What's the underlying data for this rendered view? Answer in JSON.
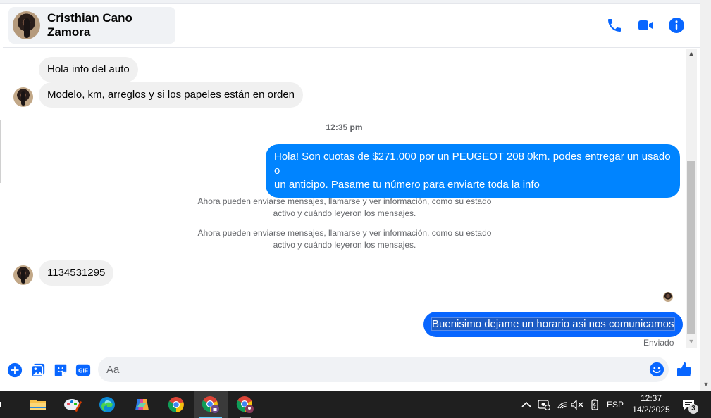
{
  "header": {
    "contact_name": "Cristhian Cano Zamora",
    "icons": [
      "phone-icon",
      "video-call-icon",
      "info-icon"
    ]
  },
  "messages": [
    {
      "direction": "in",
      "text": "Hola info del auto"
    },
    {
      "direction": "in",
      "text": "Modelo, km, arreglos y si los papeles están en orden"
    },
    {
      "type": "timestamp",
      "text": "12:35 pm"
    },
    {
      "direction": "out",
      "line1": "Hola! Son cuotas de $271.000 por un PEUGEOT 208 0km. podes entregar un usado o",
      "line2": "un anticipo. Pasame tu número para enviarte toda la info"
    },
    {
      "type": "system",
      "line1": "Ahora pueden enviarse mensajes, llamarse y ver información, como su estado",
      "line2": "activo y cuándo leyeron los mensajes."
    },
    {
      "type": "system",
      "line1": "Ahora pueden enviarse mensajes, llamarse y ver información, como su estado",
      "line2": "activo y cuándo leyeron los mensajes."
    },
    {
      "direction": "in",
      "text": "1134531295"
    },
    {
      "direction": "out",
      "text": "Buenisimo dejame un horario asi nos comunicamos",
      "status": "Enviado"
    }
  ],
  "composer": {
    "placeholder": "Aa",
    "icons": [
      "plus-icon",
      "photo-icon",
      "sticker-icon",
      "gif-icon",
      "emoji-icon",
      "like-icon"
    ],
    "gif_label": "GIF"
  },
  "taskbar": {
    "apps": [
      "task-view",
      "file-explorer",
      "paint-app",
      "edge-browser",
      "copilot-app",
      "chrome-browser",
      "chrome-profile-active",
      "chrome-profile-2"
    ],
    "language": "ESP",
    "time": "12:37",
    "date": "14/2/2025",
    "notifications": "3"
  },
  "colors": {
    "accent": "#0866ff",
    "outgoing_bubble": "#0084ff",
    "incoming_bubble": "#f0f0f0",
    "taskbar": "#1f1f1f"
  }
}
